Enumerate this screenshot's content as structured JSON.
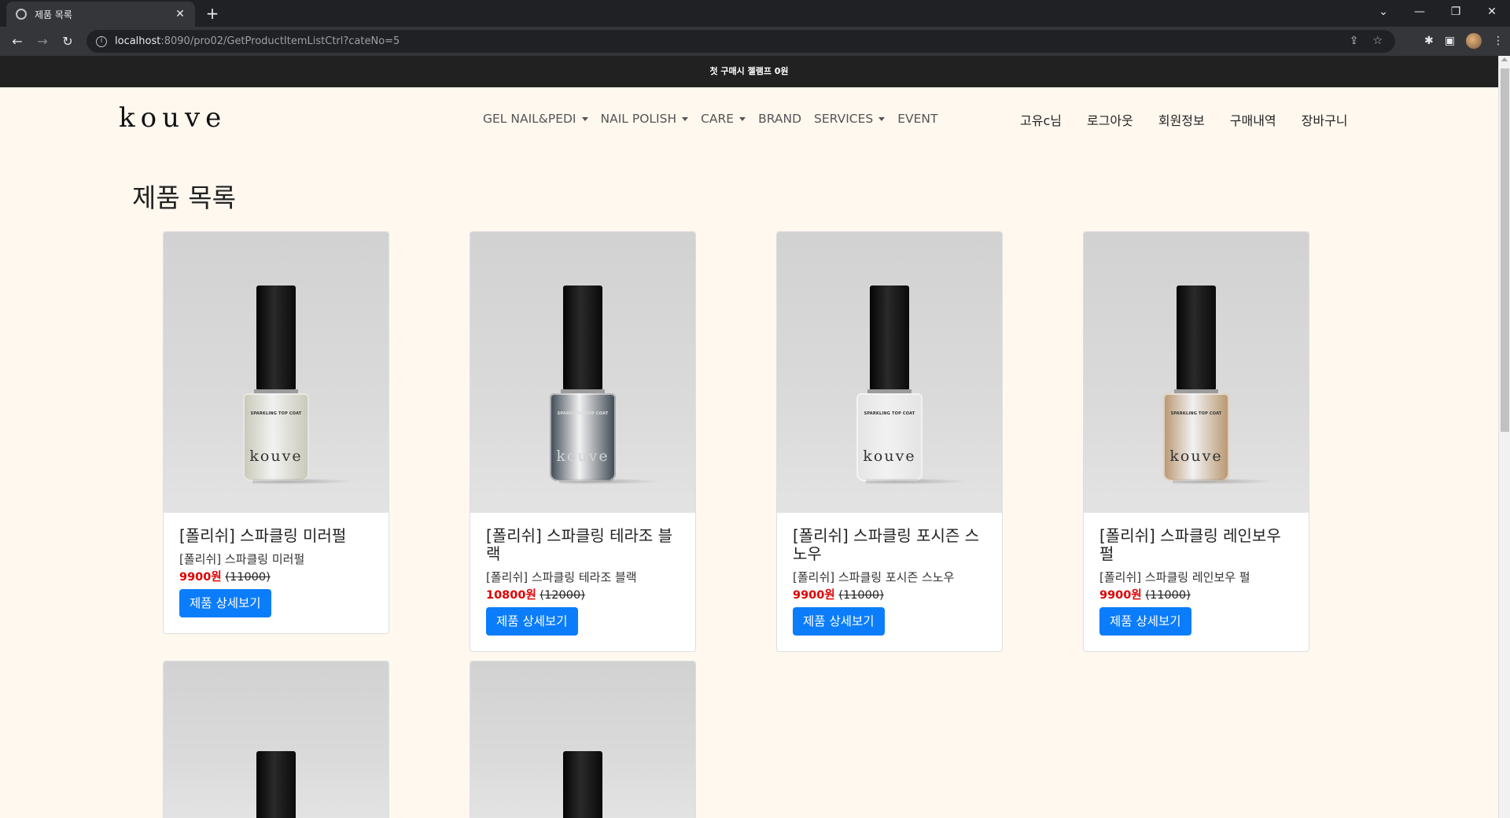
{
  "browser": {
    "tab_title": "제품 목록",
    "url_host": "localhost",
    "url_rest": ":8090/pro02/GetProductItemListCtrl?cateNo=5",
    "icons": [
      "back-icon",
      "forward-icon",
      "reload-icon",
      "info-icon",
      "share-icon",
      "star-icon",
      "extensions-icon",
      "sidepanel-icon",
      "menu-icon"
    ]
  },
  "promo": {
    "text": "첫 구매시 젤램프 0원"
  },
  "site": {
    "logo": "kouve",
    "nav": [
      {
        "label": "GEL NAIL&PEDI",
        "dropdown": true
      },
      {
        "label": "NAIL POLISH",
        "dropdown": true
      },
      {
        "label": "CARE",
        "dropdown": true
      },
      {
        "label": "BRAND",
        "dropdown": false
      },
      {
        "label": "SERVICES",
        "dropdown": true
      },
      {
        "label": "EVENT",
        "dropdown": false
      }
    ],
    "user_nav": [
      "고유c님",
      "로그아웃",
      "회원정보",
      "구매내역",
      "장바구니"
    ]
  },
  "page_title": "제품 목록",
  "products": [
    {
      "name": "[폴리쉬] 스파클링 미러펄",
      "desc": "[폴리쉬] 스파클링 미러펄",
      "sale_price": "9900원",
      "orig_price": "(11000)",
      "button": "제품 상세보기",
      "bottle_label": "SPARKLING TOP COAT",
      "bottle_brand": "kouve",
      "glass_color": "#c8c8b8"
    },
    {
      "name": "[폴리쉬] 스파클링 테라조 블랙",
      "desc": "[폴리쉬] 스파클링 테라조 블랙",
      "sale_price": "10800원",
      "orig_price": "(12000)",
      "button": "제품 상세보기",
      "bottle_label": "SPARKLING TOP COAT",
      "bottle_brand": "kouve",
      "glass_color": "#3c4650"
    },
    {
      "name": "[폴리쉬] 스파클링 포시즌 스노우",
      "desc": "[폴리쉬] 스파클링 포시즌 스노우",
      "sale_price": "9900원",
      "orig_price": "(11000)",
      "button": "제품 상세보기",
      "bottle_label": "SPARKLING TOP COAT",
      "bottle_brand": "kouve",
      "glass_color": "#e4e4e4"
    },
    {
      "name": "[폴리쉬] 스파클링 레인보우 펄",
      "desc": "[폴리쉬] 스파클링 레인보우 펄",
      "sale_price": "9900원",
      "orig_price": "(11000)",
      "button": "제품 상세보기",
      "bottle_label": "SPARKLING TOP COAT",
      "bottle_brand": "kouve",
      "glass_color": "#b7956e"
    }
  ]
}
